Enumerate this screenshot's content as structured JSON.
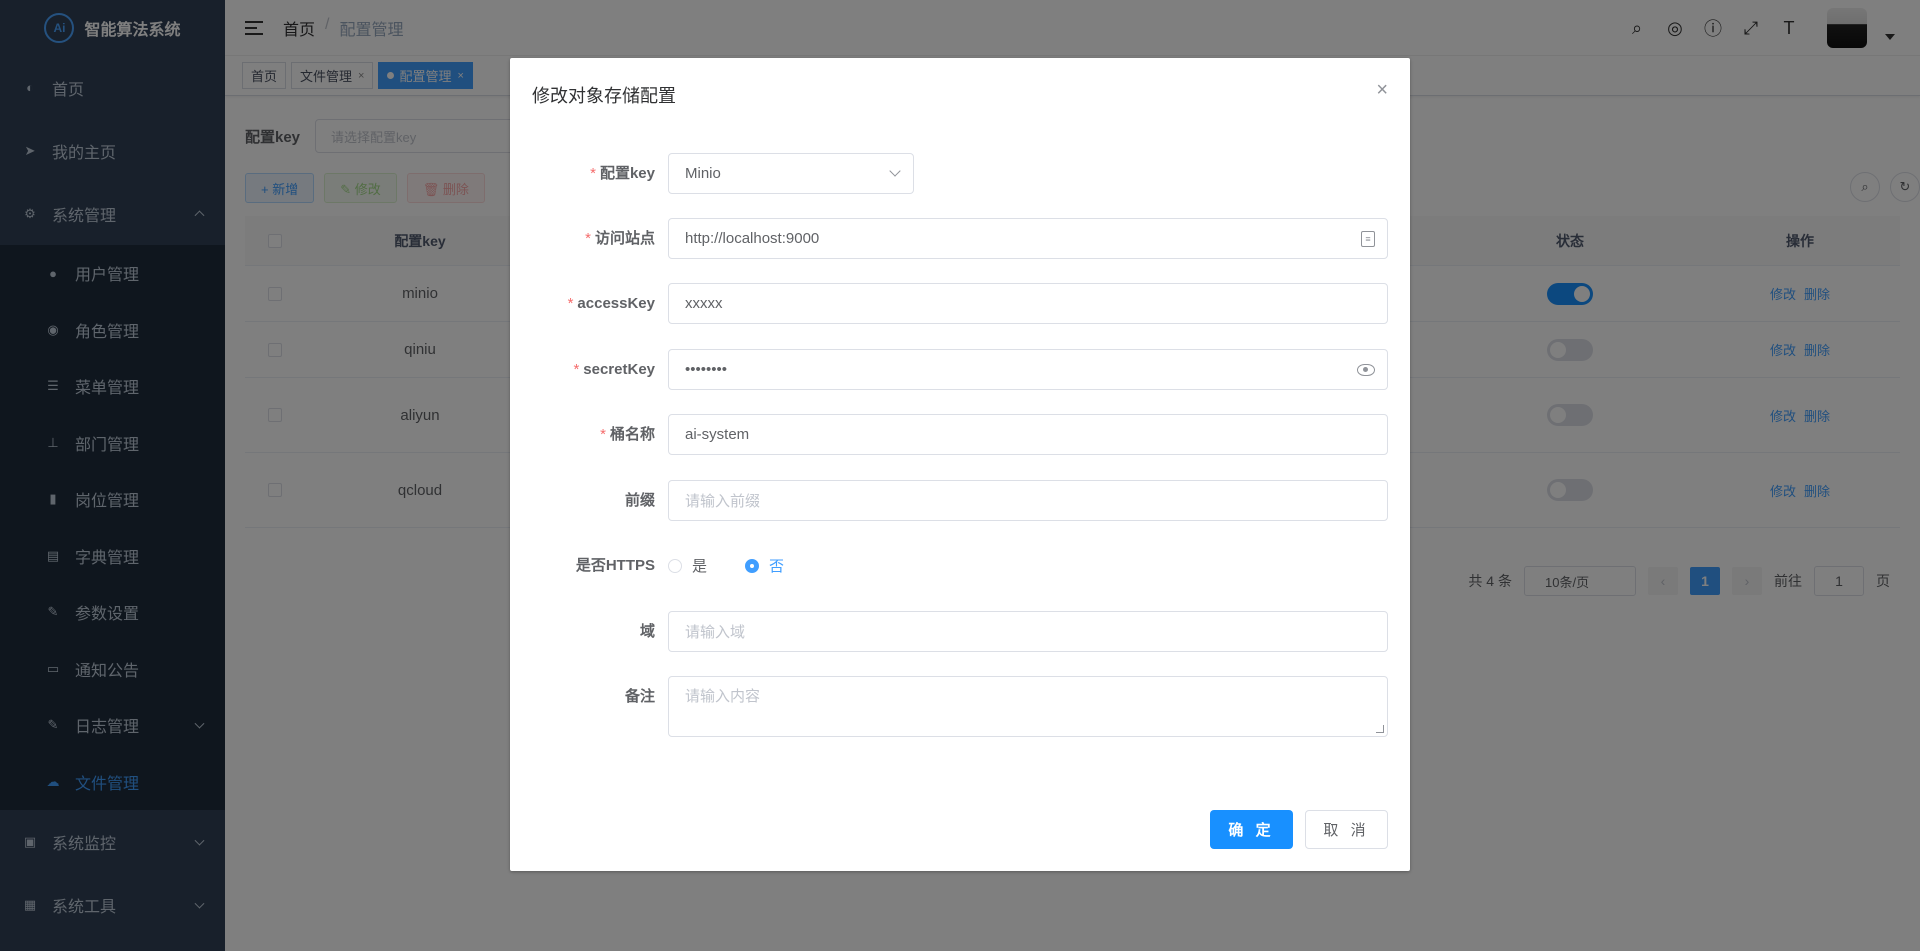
{
  "app": {
    "logo_mark": "Ai",
    "title": "智能算法系统"
  },
  "sidebar": {
    "items": [
      {
        "label": "首页",
        "icon": "dashboard-icon"
      },
      {
        "label": "我的主页",
        "icon": "send-icon"
      },
      {
        "label": "系统管理",
        "icon": "gear-icon"
      }
    ],
    "sub_items": [
      {
        "label": "用户管理",
        "icon": "user-icon"
      },
      {
        "label": "角色管理",
        "icon": "role-icon"
      },
      {
        "label": "菜单管理",
        "icon": "menu-tree-icon"
      },
      {
        "label": "部门管理",
        "icon": "org-chart-icon"
      },
      {
        "label": "岗位管理",
        "icon": "post-icon"
      },
      {
        "label": "字典管理",
        "icon": "dictionary-icon"
      },
      {
        "label": "参数设置",
        "icon": "edit-icon"
      },
      {
        "label": "通知公告",
        "icon": "message-icon"
      },
      {
        "label": "日志管理",
        "icon": "log-icon"
      },
      {
        "label": "文件管理",
        "icon": "upload-cloud-icon"
      }
    ],
    "bottom_items": [
      {
        "label": "系统监控",
        "icon": "monitor-icon"
      },
      {
        "label": "系统工具",
        "icon": "toolbox-icon"
      }
    ]
  },
  "navbar": {
    "breadcrumb_home": "首页",
    "breadcrumb_sep": "/",
    "breadcrumb_current": "配置管理"
  },
  "tags": {
    "home": "首页",
    "files": "文件管理",
    "config": "配置管理",
    "close": "×"
  },
  "search": {
    "label": "配置key",
    "placeholder": "请选择配置key"
  },
  "toolbar": {
    "add": "+ 新增",
    "edit": "✎ 修改",
    "delete": "🗑 删除"
  },
  "table": {
    "headers": {
      "key": "配置key",
      "status": "状态",
      "ops": "操作"
    },
    "rows": [
      {
        "key": "minio",
        "enabled": true
      },
      {
        "key": "qiniu",
        "enabled": false
      },
      {
        "key": "aliyun",
        "enabled": false
      },
      {
        "key": "qcloud",
        "enabled": false
      }
    ],
    "op_edit": "修改",
    "op_delete": "删除"
  },
  "pagination": {
    "total": "共 4 条",
    "page_size": "10条/页",
    "current_page": "1",
    "goto": "前往",
    "goto_value": "1",
    "page_unit": "页"
  },
  "dialog": {
    "title": "修改对象存储配置",
    "close": "×",
    "fields": {
      "config_key": {
        "label": "配置key",
        "value": "Minio"
      },
      "endpoint": {
        "label": "访问站点",
        "value": "http://localhost:9000"
      },
      "access_key": {
        "label": "accessKey",
        "value": "xxxxx"
      },
      "secret_key": {
        "label": "secretKey",
        "value": "••••••••"
      },
      "bucket": {
        "label": "桶名称",
        "value": "ai-system"
      },
      "prefix": {
        "label": "前缀",
        "placeholder": "请输入前缀"
      },
      "https": {
        "label": "是否HTTPS",
        "option_yes": "是",
        "option_no": "否",
        "selected": "否"
      },
      "domain": {
        "label": "域",
        "placeholder": "请输入域"
      },
      "remark": {
        "label": "备注",
        "placeholder": "请输入内容"
      }
    },
    "confirm": "确 定",
    "cancel": "取 消"
  },
  "colors": {
    "sidebar_bg": "#304156",
    "submenu_bg": "#1f2d3d",
    "primary": "#1890ff",
    "active_tag": "#409eff",
    "required": "#f56c6c"
  }
}
